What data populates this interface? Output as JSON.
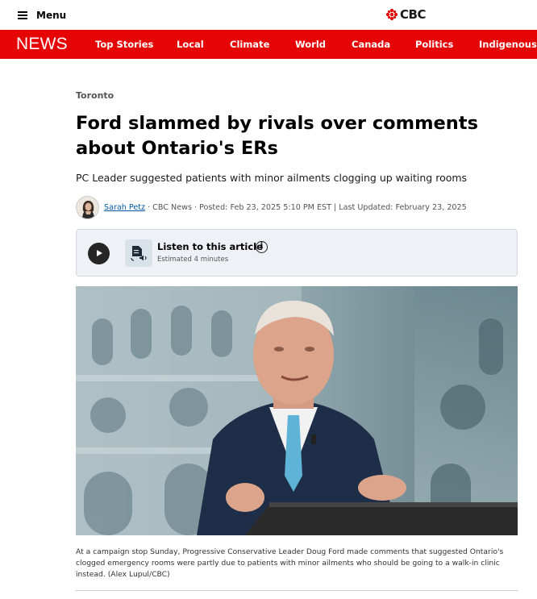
{
  "header": {
    "menu_label": "Menu",
    "logo_text": "CBC",
    "brand_color": "#e60505"
  },
  "nav": {
    "brand": "NEWS",
    "items": [
      "Top Stories",
      "Local",
      "Climate",
      "World",
      "Canada",
      "Politics",
      "Indigenous"
    ]
  },
  "article": {
    "kicker": "Toronto",
    "headline": "Ford slammed by rivals over comments about Ontario's ERs",
    "dek": "PC Leader suggested patients with minor ailments clogging up waiting rooms",
    "byline": {
      "author": "Sarah Petz",
      "source": "· CBC News · Posted: Feb 23, 2025 5:10 PM EST | Last Updated: February 23, 2025"
    },
    "listen": {
      "title": "Listen to this article",
      "estimate": "Estimated 4 minutes",
      "info_glyph": "i"
    },
    "photo_caption": "At a campaign stop Sunday, Progressive Conservative Leader Doug Ford made comments that suggested Ontario's clogged emergency rooms were partly due to patients with minor ailments who should be going to a walk-in clinic instead. (Alex Lupul/CBC)"
  }
}
